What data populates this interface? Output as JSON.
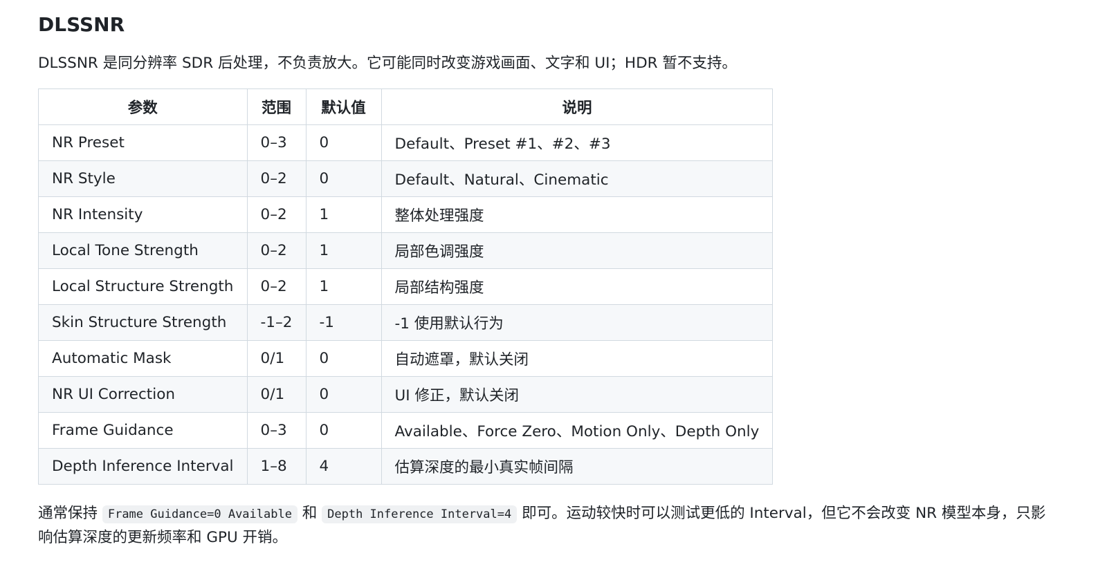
{
  "heading": "DLSSNR",
  "intro": "DLSSNR 是同分辨率 SDR 后处理，不负责放大。它可能同时改变游戏画面、文字和 UI；HDR 暂不支持。",
  "table": {
    "headers": [
      "参数",
      "范围",
      "默认值",
      "说明"
    ],
    "rows": [
      [
        "NR Preset",
        "0–3",
        "0",
        "Default、Preset #1、#2、#3"
      ],
      [
        "NR Style",
        "0–2",
        "0",
        "Default、Natural、Cinematic"
      ],
      [
        "NR Intensity",
        "0–2",
        "1",
        "整体处理强度"
      ],
      [
        "Local Tone Strength",
        "0–2",
        "1",
        "局部色调强度"
      ],
      [
        "Local Structure Strength",
        "0–2",
        "1",
        "局部结构强度"
      ],
      [
        "Skin Structure Strength",
        "-1–2",
        "-1",
        "-1 使用默认行为"
      ],
      [
        "Automatic Mask",
        "0/1",
        "0",
        "自动遮罩，默认关闭"
      ],
      [
        "NR UI Correction",
        "0/1",
        "0",
        "UI 修正，默认关闭"
      ],
      [
        "Frame Guidance",
        "0–3",
        "0",
        "Available、Force Zero、Motion Only、Depth Only"
      ],
      [
        "Depth Inference Interval",
        "1–8",
        "4",
        "估算深度的最小真实帧间隔"
      ]
    ]
  },
  "footnote": {
    "part1": "通常保持 ",
    "code1": "Frame Guidance=0 Available",
    "part2": " 和 ",
    "code2": "Depth Inference Interval=4",
    "part3": " 即可。运动较快时可以测试更低的 Interval，但它不会改变 NR 模型本身，只影响估算深度的更新频率和 GPU 开销。"
  }
}
